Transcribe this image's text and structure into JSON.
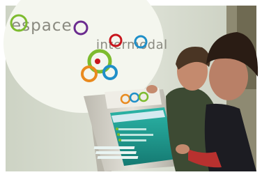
{
  "sign": {
    "brand_words": [
      "espace",
      "intermodal"
    ]
  },
  "kiosk": {
    "screen_color": "#1e9a8f",
    "body_color": "#d9d7cf"
  },
  "colors": {
    "wall": "#d8ddd0",
    "sign_disc": "#f4f6ee",
    "ring_green": "#7dbb2e",
    "ring_orange": "#e98a1e",
    "ring_red": "#c8161d",
    "ring_blue": "#1f8fc8",
    "ring_purple": "#6b2c8f"
  }
}
